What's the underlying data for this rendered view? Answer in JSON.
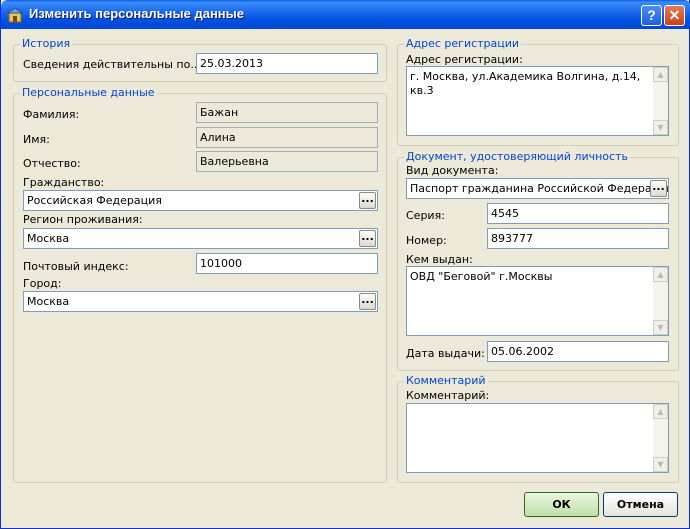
{
  "window": {
    "title": "Изменить персональные данные",
    "help_label": "?",
    "close_label": "✕"
  },
  "history": {
    "legend": "История",
    "valid_label": "Сведения действительны по...:",
    "valid_value": "25.03.2013"
  },
  "personal": {
    "legend": "Персональные данные",
    "surname_label": "Фамилия:",
    "surname_value": "Бажан",
    "name_label": "Имя:",
    "name_value": "Алина",
    "patronymic_label": "Отчество:",
    "patronymic_value": "Валерьевна",
    "citizenship_label": "Гражданство:",
    "citizenship_value": "Российская Федерация",
    "region_label": "Регион проживания:",
    "region_value": "Москва",
    "postcode_label": "Почтовый индекс:",
    "postcode_value": "101000",
    "city_label": "Город:",
    "city_value": "Москва"
  },
  "registration": {
    "legend": "Адрес регистрации",
    "address_label": "Адрес регистрации:",
    "address_value": "г. Москва, ул.Академика Волгина, д.14, кв.3"
  },
  "document": {
    "legend": "Документ, удостоверяющий личность",
    "type_label": "Вид документа:",
    "type_value": "Паспорт гражданина Российской Федерации",
    "series_label": "Серия:",
    "series_value": "4545",
    "number_label": "Номер:",
    "number_value": "893777",
    "issued_by_label": "Кем выдан:",
    "issued_by_value": "ОВД \"Беговой\" г.Москвы",
    "issue_date_label": "Дата выдачи:",
    "issue_date_value": "05.06.2002"
  },
  "comment": {
    "legend": "Комментарий",
    "label": "Комментарий:",
    "value": ""
  },
  "buttons": {
    "ok": "ОК",
    "cancel": "Отмена",
    "ellipsis": "..."
  }
}
